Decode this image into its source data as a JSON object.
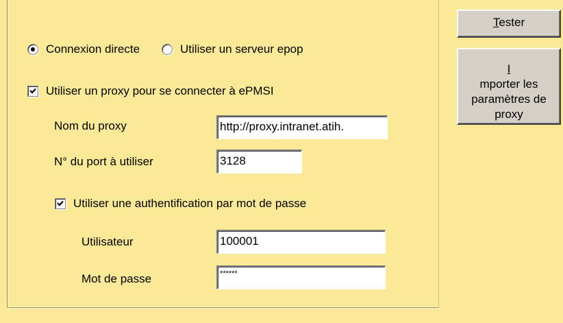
{
  "connection": {
    "direct_label": "Connexion directe",
    "epop_label": "Utiliser un serveur epop",
    "selected": "direct"
  },
  "proxy": {
    "use_proxy_label": "Utiliser un proxy pour se connecter à ePMSI",
    "use_proxy_checked": true,
    "name_label": "Nom du proxy",
    "name_value": "http://proxy.intranet.atih.",
    "port_label": "N° du port à utiliser",
    "port_value": "3128"
  },
  "auth": {
    "use_auth_label": "Utiliser une authentification par mot de passe",
    "use_auth_checked": true,
    "user_label": "Utilisateur",
    "user_value": "100001",
    "password_label": "Mot de passe",
    "password_value": "******"
  },
  "buttons": {
    "tester_mnemonic": "T",
    "tester_rest": "ester",
    "import_mnemonic": "I",
    "import_line1_rest": "mporter les",
    "import_line2": "paramètres de",
    "import_line3": "proxy"
  },
  "colors": {
    "background": "#fbe99a",
    "button_face": "#d4d0c8"
  }
}
